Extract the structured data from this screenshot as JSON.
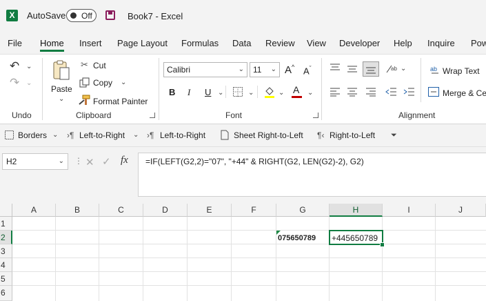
{
  "titlebar": {
    "app_icon": "excel-logo-icon",
    "autosave_label": "AutoSave",
    "autosave_state": "Off",
    "save_icon": "save-icon",
    "document_title": "Book7  -  Excel"
  },
  "menu": {
    "items": [
      "File",
      "Home",
      "Insert",
      "Page Layout",
      "Formulas",
      "Data",
      "Review",
      "View",
      "Developer",
      "Help",
      "Inquire",
      "Pow"
    ],
    "active": "Home"
  },
  "ribbon": {
    "undo": {
      "label": "Undo",
      "undo_icon": "undo-icon",
      "redo_icon": "redo-icon"
    },
    "clipboard": {
      "label": "Clipboard",
      "paste": "Paste",
      "cut": "Cut",
      "copy": "Copy",
      "format_painter": "Format Painter"
    },
    "font": {
      "label": "Font",
      "font_name": "Calibri",
      "font_size": "11",
      "grow": "A",
      "shrink": "A",
      "bold": "B",
      "italic": "I",
      "underline": "U",
      "font_color_glyph": "A"
    },
    "alignment": {
      "label": "Alignment",
      "wrap_text": "Wrap Text",
      "merge": "Merge & Ce"
    }
  },
  "quickbar": {
    "borders": "Borders",
    "ltr_dropdown": "Left-to-Right",
    "ltr": "Left-to-Right",
    "sheet_rtl": "Sheet Right-to-Left",
    "rtl": "Right-to-Left"
  },
  "formula_bar": {
    "name_box": "H2",
    "fx": "fx",
    "formula": "=IF(LEFT(G2,2)=\"07\", \"+44\" & RIGHT(G2, LEN(G2)-2), G2)"
  },
  "grid": {
    "columns": [
      "A",
      "B",
      "C",
      "D",
      "E",
      "F",
      "G",
      "H",
      "I",
      "J"
    ],
    "rows": [
      "1",
      "2",
      "3",
      "4",
      "5",
      "6"
    ],
    "selected_column": "H",
    "selected_row": "2",
    "cells": {
      "G2": "075650789",
      "H2": "+445650789"
    }
  },
  "colors": {
    "accent": "#107c41",
    "save_icon": "#8a1c5c",
    "font_color_bar": "#c00000",
    "fill_color_bar": "#ffff00"
  }
}
